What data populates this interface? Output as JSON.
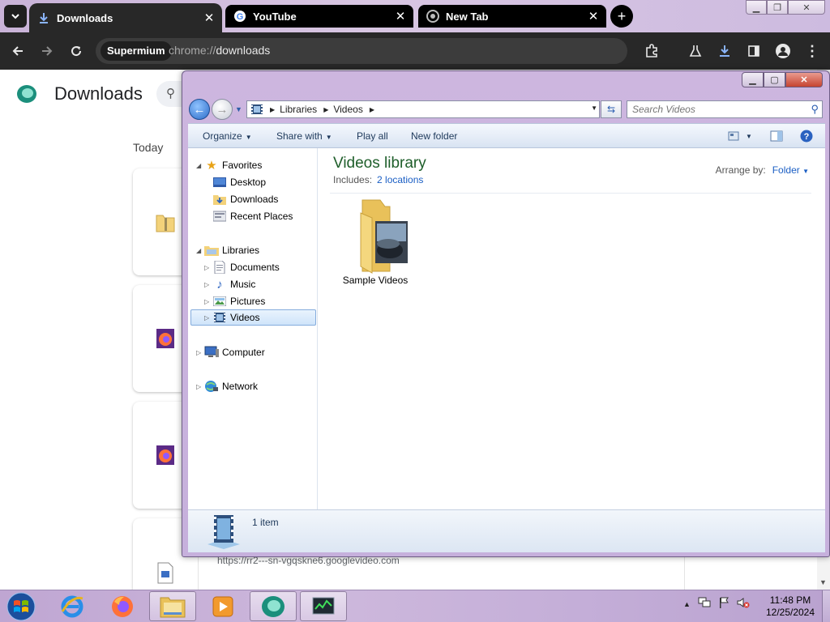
{
  "browser": {
    "tabs": [
      {
        "label": "Downloads",
        "favicon": "download-icon",
        "active": true
      },
      {
        "label": "YouTube",
        "favicon": "google-icon",
        "active": false
      },
      {
        "label": "New Tab",
        "favicon": "chrome-icon",
        "active": false
      }
    ],
    "omnibox": {
      "chip": "Supermium",
      "url_scheme": "chrome://",
      "url_path": "downloads"
    },
    "accent": "#1a73e8"
  },
  "downloads_page": {
    "title": "Downloads",
    "section_label": "Today",
    "partial_url": "https://rr2---sn-vgqskne6.googlevideo.com"
  },
  "explorer": {
    "breadcrumb": [
      "Libraries",
      "Videos"
    ],
    "search_placeholder": "Search Videos",
    "commands": {
      "organize": "Organize",
      "share_with": "Share with",
      "play_all": "Play all",
      "new_folder": "New folder"
    },
    "nav": {
      "favorites": "Favorites",
      "desktop": "Desktop",
      "downloads": "Downloads",
      "recent_places": "Recent Places",
      "libraries": "Libraries",
      "documents": "Documents",
      "music": "Music",
      "pictures": "Pictures",
      "videos": "Videos",
      "computer": "Computer",
      "network": "Network"
    },
    "library": {
      "title": "Videos library",
      "includes_label": "Includes:",
      "includes_link": "2 locations",
      "arrange_label": "Arrange by:",
      "arrange_value": "Folder"
    },
    "items": [
      {
        "name": "Sample Videos",
        "type": "folder"
      }
    ],
    "status": "1 item"
  },
  "taskbar": {
    "apps": [
      "internet-explorer-icon",
      "firefox-icon",
      "explorer-icon",
      "media-player-icon",
      "supermium-icon",
      "task-manager-icon"
    ],
    "time": "11:48 PM",
    "date": "12/25/2024"
  }
}
